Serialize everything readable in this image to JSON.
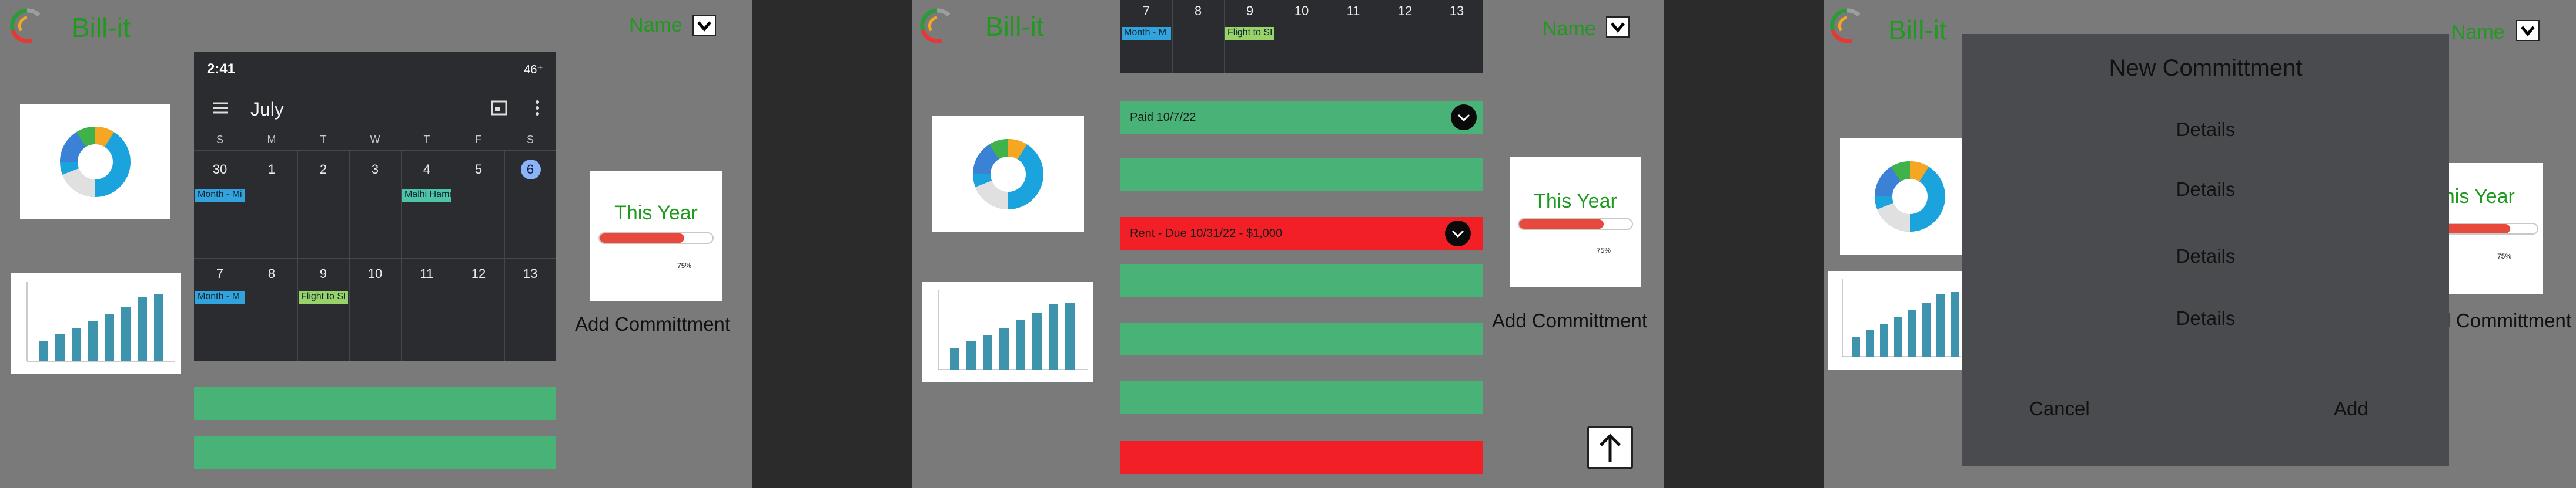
{
  "app": {
    "name": "Bill-it",
    "user_menu_label": "Name"
  },
  "icons": {
    "logo": "circular-arc-logo-icon",
    "dropdown": "chevron-down-icon",
    "row_expand": "chevron-down-icon",
    "scroll_top": "arrow-up-icon",
    "cal_menu": "hamburger-menu-icon",
    "cal_today": "calendar-icon",
    "cal_more": "more-vert-icon"
  },
  "colors": {
    "brand_green": "#1f9a1f",
    "paid_row": "#49b377",
    "due_row": "#f31f26",
    "progress_fill": "#e8493d",
    "screen_bg": "#7a7a7a"
  },
  "summary_card": {
    "title": "This Year",
    "progress": 0.75,
    "progress_label": "75%"
  },
  "add_commitment_label": "Add Committment",
  "calendar": {
    "status_time": "2:41",
    "status_right": "46⁺",
    "month": "July",
    "weekday_headers": [
      "S",
      "M",
      "T",
      "W",
      "T",
      "F",
      "S"
    ],
    "week1_days": [
      "30",
      "1",
      "2",
      "3",
      "4",
      "5",
      "6"
    ],
    "week2_days": [
      "7",
      "8",
      "9",
      "10",
      "11",
      "12",
      "13"
    ],
    "events": {
      "monthly_1": "Month - Mi",
      "hawaii": "Malhi Hama",
      "monthly_2": "Month - M",
      "flight": "Flight to SI"
    }
  },
  "screen2": {
    "rows": [
      {
        "text": "Paid 10/7/22",
        "status": "paid"
      },
      {
        "text": "",
        "status": "paid"
      },
      {
        "text": "Rent - Due 10/31/22 - $1,000",
        "status": "due"
      },
      {
        "text": "",
        "status": "paid"
      },
      {
        "text": "",
        "status": "paid"
      },
      {
        "text": "",
        "status": "paid"
      },
      {
        "text": "",
        "status": "due"
      }
    ]
  },
  "modal": {
    "title": "New Committment",
    "fields": [
      "Details",
      "Details",
      "Details",
      "Details"
    ],
    "cancel_label": "Cancel",
    "add_label": "Add"
  }
}
